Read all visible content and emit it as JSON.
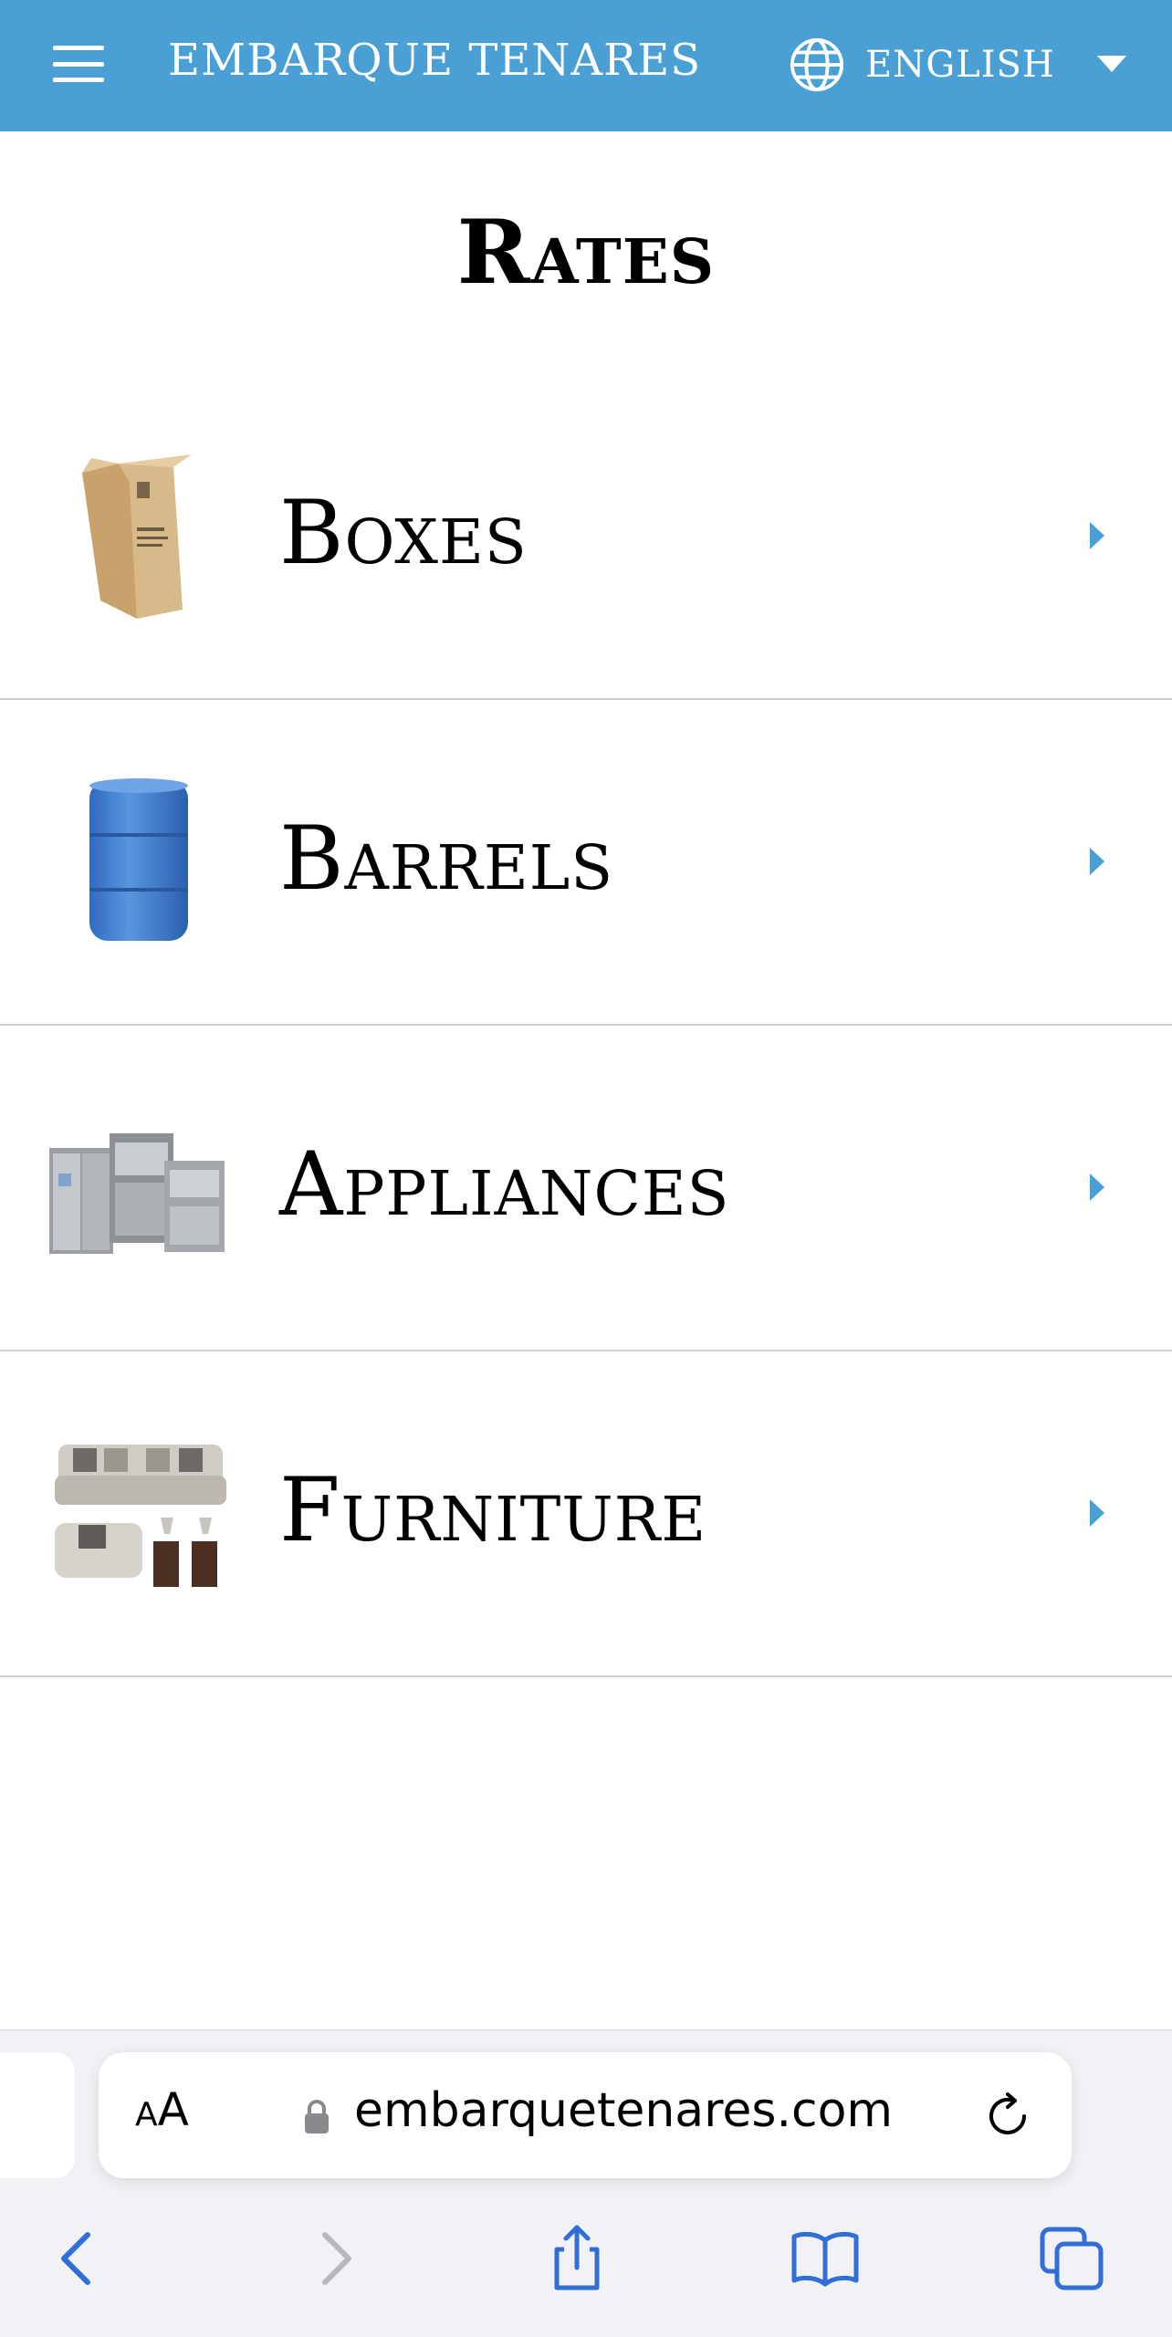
{
  "header": {
    "brand": "EMBARQUE TENARES",
    "language": "ENGLISH"
  },
  "page": {
    "title": "Rates"
  },
  "rates": [
    {
      "label": "Boxes",
      "icon": "box-image"
    },
    {
      "label": "Barrels",
      "icon": "barrel-image"
    },
    {
      "label": "Appliances",
      "icon": "appliances-image"
    },
    {
      "label": "Furniture",
      "icon": "furniture-image"
    }
  ],
  "browser": {
    "aa_small": "A",
    "aa_big": "A",
    "url": "embarquetenares.com"
  },
  "colors": {
    "header_bg": "#4a9fd5",
    "accent": "#4a9fd5",
    "ios_blue": "#2f6fd6"
  }
}
